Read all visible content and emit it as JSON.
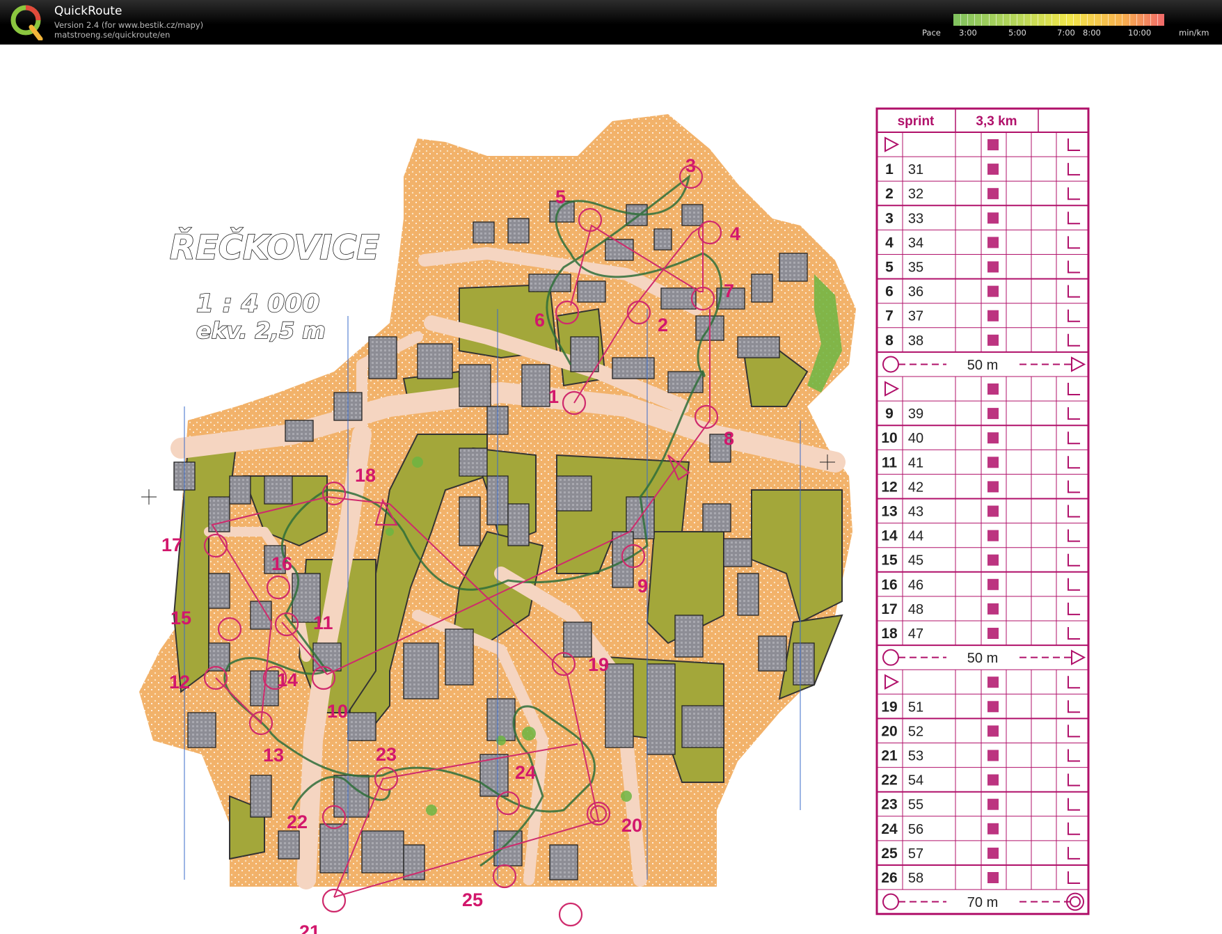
{
  "app": {
    "title": "QuickRoute",
    "version": "Version 2.4  (for www.bestik.cz/mapy)",
    "url": "matstroeng.se/quickroute/en"
  },
  "pace": {
    "label": "Pace",
    "ticks": [
      "3:00",
      "5:00",
      "7:00",
      "8:00",
      "10:00"
    ],
    "unit": "min/km"
  },
  "map": {
    "name": "ŘEČKOVICE",
    "scale": "1 : 4 000",
    "contour": "ekv. 2,5 m"
  },
  "controls": [
    "1",
    "2",
    "3",
    "4",
    "5",
    "6",
    "7",
    "8",
    "9",
    "10",
    "11",
    "12",
    "13",
    "14",
    "15",
    "16",
    "17",
    "18",
    "19",
    "20",
    "21",
    "22",
    "23",
    "24",
    "25",
    "26"
  ],
  "description_sheet": {
    "class": "sprint",
    "length": "3,3 km",
    "rows": [
      {
        "type": "start"
      },
      {
        "num": "1",
        "code": "31"
      },
      {
        "num": "2",
        "code": "32"
      },
      {
        "num": "3",
        "code": "33"
      },
      {
        "num": "4",
        "code": "34"
      },
      {
        "num": "5",
        "code": "35"
      },
      {
        "num": "6",
        "code": "36"
      },
      {
        "num": "7",
        "code": "37"
      },
      {
        "num": "8",
        "code": "38"
      },
      {
        "type": "marked",
        "text": "50 m"
      },
      {
        "type": "start"
      },
      {
        "num": "9",
        "code": "39"
      },
      {
        "num": "10",
        "code": "40"
      },
      {
        "num": "11",
        "code": "41"
      },
      {
        "num": "12",
        "code": "42"
      },
      {
        "num": "13",
        "code": "43"
      },
      {
        "num": "14",
        "code": "44"
      },
      {
        "num": "15",
        "code": "45"
      },
      {
        "num": "16",
        "code": "46"
      },
      {
        "num": "17",
        "code": "48"
      },
      {
        "num": "18",
        "code": "47"
      },
      {
        "type": "marked",
        "text": "50 m"
      },
      {
        "type": "start"
      },
      {
        "num": "19",
        "code": "51"
      },
      {
        "num": "20",
        "code": "52"
      },
      {
        "num": "21",
        "code": "53"
      },
      {
        "num": "22",
        "code": "54"
      },
      {
        "num": "23",
        "code": "55"
      },
      {
        "num": "24",
        "code": "56"
      },
      {
        "num": "25",
        "code": "57"
      },
      {
        "num": "26",
        "code": "58"
      },
      {
        "type": "finish",
        "text": "70 m"
      }
    ]
  }
}
